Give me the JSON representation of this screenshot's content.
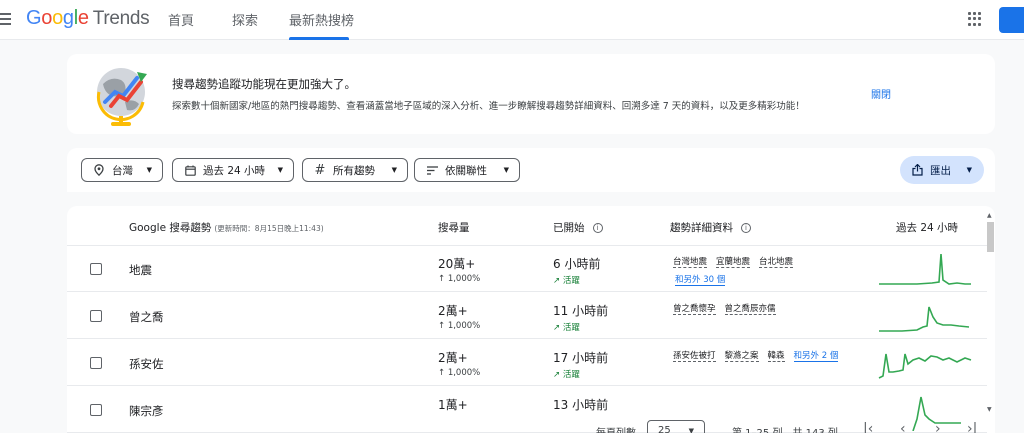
{
  "app": {
    "logo_google": "Google",
    "logo_trends": "Trends"
  },
  "nav": {
    "tabs": [
      "首頁",
      "探索",
      "最新熱搜榜"
    ],
    "active_tab": "最新熱搜榜"
  },
  "banner": {
    "title": "搜尋趨勢追蹤功能現在更加強大了。",
    "description": "探索數十個新國家/地區的熱門搜尋趨勢、查看涵蓋當地子區域的深入分析、進一步瞭解搜尋趨勢詳細資料、回溯多達 7 天的資料，以及更多精彩功能！",
    "close_label": "關閉"
  },
  "filters": {
    "location": "台灣",
    "time": "過去 24 小時",
    "category": "所有趨勢",
    "sort": "依關聯性",
    "export_label": "匯出"
  },
  "table": {
    "headers": {
      "trend": "Google 搜尋趨勢",
      "updated": "(更新時間：8月15日晚上11:43)",
      "volume": "搜尋量",
      "started": "已開始",
      "details": "趨勢詳細資料",
      "past24": "過去 24 小時"
    },
    "rows": [
      {
        "term": "地震",
        "volume": "20萬+",
        "change": "↑ 1,000%",
        "started": "6 小時前",
        "status": "活躍",
        "tags": [
          "台灣地震",
          "宜蘭地震",
          "台北地震"
        ],
        "more": "和另外 30 個"
      },
      {
        "term": "曾之喬",
        "volume": "2萬+",
        "change": "↑ 1,000%",
        "started": "11 小時前",
        "status": "活躍",
        "tags": [
          "曾之喬懷孕",
          "曾之喬辰亦儒"
        ],
        "more": ""
      },
      {
        "term": "孫安佐",
        "volume": "2萬+",
        "change": "↑ 1,000%",
        "started": "17 小時前",
        "status": "活躍",
        "tags": [
          "孫安佐被打",
          "黎滌之案",
          "韓森"
        ],
        "more": "和另外 2 個"
      },
      {
        "term": "陳宗彥",
        "volume": "1萬+",
        "change": "",
        "started": "13 小時前",
        "status": "",
        "tags": [],
        "more": ""
      }
    ]
  },
  "pagination": {
    "rows_per_page_label": "每頁列數",
    "rows_per_page": "25",
    "range": "第 1–25 列，共 143 列"
  },
  "colors": {
    "accent": "#1a73e8",
    "spark": "#34a853",
    "active": "#188038"
  }
}
